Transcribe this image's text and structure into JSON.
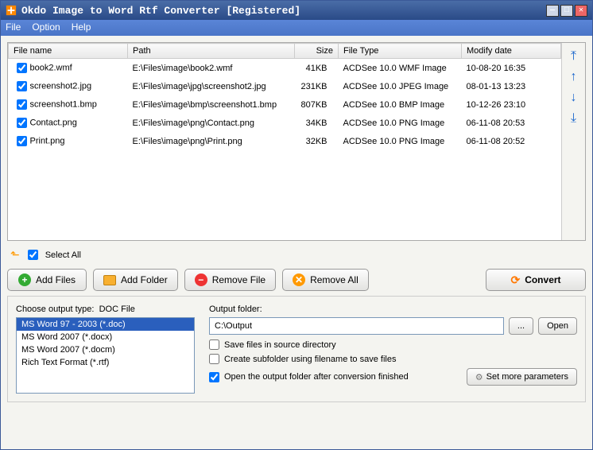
{
  "title": "Okdo Image to Word Rtf Converter [Registered]",
  "menu": {
    "file": "File",
    "option": "Option",
    "help": "Help"
  },
  "columns": {
    "name": "File name",
    "path": "Path",
    "size": "Size",
    "type": "File Type",
    "modify": "Modify date"
  },
  "files": [
    {
      "checked": true,
      "name": "book2.wmf",
      "path": "E:\\Files\\image\\book2.wmf",
      "size": "41KB",
      "type": "ACDSee 10.0 WMF Image",
      "modify": "10-08-20 16:35"
    },
    {
      "checked": true,
      "name": "screenshot2.jpg",
      "path": "E:\\Files\\image\\jpg\\screenshot2.jpg",
      "size": "231KB",
      "type": "ACDSee 10.0 JPEG Image",
      "modify": "08-01-13 13:23"
    },
    {
      "checked": true,
      "name": "screenshot1.bmp",
      "path": "E:\\Files\\image\\bmp\\screenshot1.bmp",
      "size": "807KB",
      "type": "ACDSee 10.0 BMP Image",
      "modify": "10-12-26 23:10"
    },
    {
      "checked": true,
      "name": "Contact.png",
      "path": "E:\\Files\\image\\png\\Contact.png",
      "size": "34KB",
      "type": "ACDSee 10.0 PNG Image",
      "modify": "06-11-08 20:53"
    },
    {
      "checked": true,
      "name": "Print.png",
      "path": "E:\\Files\\image\\png\\Print.png",
      "size": "32KB",
      "type": "ACDSee 10.0 PNG Image",
      "modify": "06-11-08 20:52"
    }
  ],
  "selectAll": {
    "label": "Select All",
    "checked": true
  },
  "buttons": {
    "addFiles": "Add Files",
    "addFolder": "Add Folder",
    "removeFile": "Remove File",
    "removeAll": "Remove All",
    "convert": "Convert",
    "browse": "...",
    "open": "Open",
    "setMore": "Set more parameters"
  },
  "output": {
    "chooseLabel": "Choose output type:",
    "chooseValue": "DOC File",
    "types": [
      "MS Word 97 - 2003 (*.doc)",
      "MS Word 2007 (*.docx)",
      "MS Word 2007 (*.docm)",
      "Rich Text Format (*.rtf)"
    ],
    "selectedIndex": 0,
    "folderLabel": "Output folder:",
    "folderPath": "C:\\Output",
    "opt1": {
      "label": "Save files in source directory",
      "checked": false
    },
    "opt2": {
      "label": "Create subfolder using filename to save files",
      "checked": false
    },
    "opt3": {
      "label": "Open the output folder after conversion finished",
      "checked": true
    }
  }
}
